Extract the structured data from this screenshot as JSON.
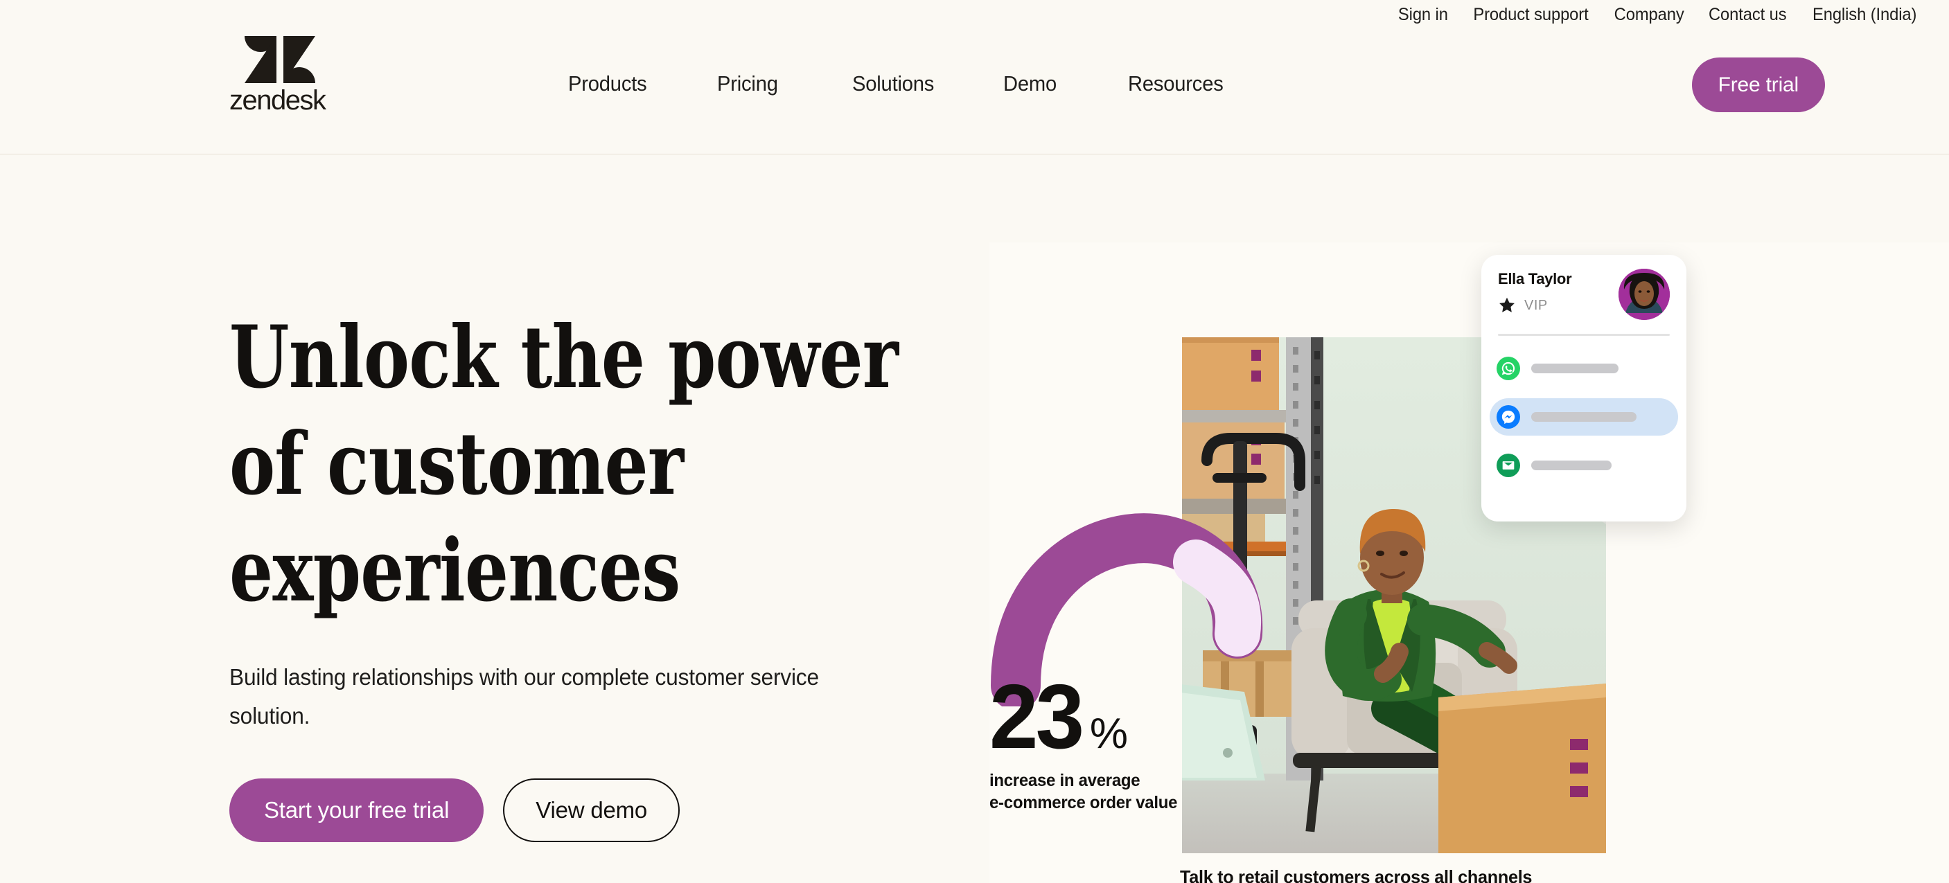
{
  "brand": {
    "name": "zendesk",
    "logo_icon": "zendesk-logo",
    "accent_purple": "#9c4a96",
    "background": "#fbf9f3",
    "text_dark": "#12100e"
  },
  "header": {
    "utility_nav": [
      {
        "label": "Sign in"
      },
      {
        "label": "Product support"
      },
      {
        "label": "Company"
      },
      {
        "label": "Contact us"
      },
      {
        "label": "English (India)"
      }
    ],
    "main_nav": [
      {
        "label": "Products"
      },
      {
        "label": "Pricing"
      },
      {
        "label": "Solutions"
      },
      {
        "label": "Demo"
      },
      {
        "label": "Resources"
      }
    ],
    "free_trial_label": "Free trial"
  },
  "hero": {
    "headline_line_1": "Unlock the power",
    "headline_line_2": "of customer",
    "headline_line_3": "experiences",
    "subtitle": "Build lasting relationships with our complete customer service solution.",
    "primary_cta": "Start your free trial",
    "secondary_cta": "View demo",
    "stat": {
      "number": "23",
      "unit": "%",
      "caption": "increase in average\ne-commerce order value"
    },
    "photo_caption": "Talk to retail customers across all channels",
    "photo_alt": "Woman in green suit seated in armchair inside a warehouse"
  },
  "chat_card": {
    "customer_name": "Ella Taylor",
    "badge_icon": "star-icon",
    "badge_label": "VIP",
    "avatar_icon": "customer-avatar",
    "channels": [
      {
        "icon": "whatsapp-icon",
        "color": "#25d366",
        "active": false
      },
      {
        "icon": "messenger-icon",
        "color": "#0a7cff",
        "active": true
      },
      {
        "icon": "email-icon",
        "color": "#0f9d58",
        "active": false
      }
    ]
  }
}
